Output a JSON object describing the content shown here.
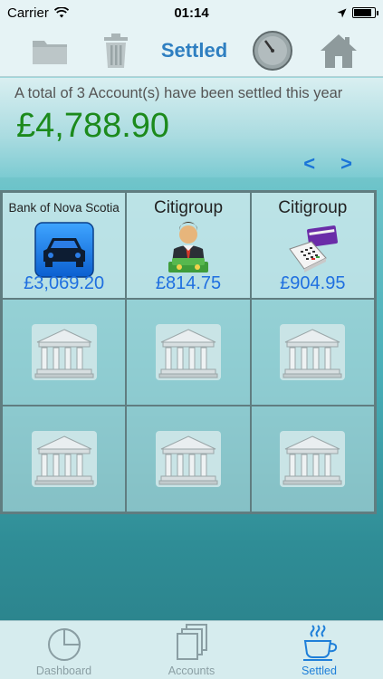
{
  "status_bar": {
    "carrier": "Carrier",
    "time": "01:14",
    "battery_level": 0.9
  },
  "toolbar": {
    "title": "Settled"
  },
  "summary": {
    "info": "A total of 3 Account(s) have been settled this year",
    "total": "£4,788.90",
    "prev": "<",
    "next": ">"
  },
  "grid": {
    "accounts": [
      {
        "bank": "Bank of Nova Scotia",
        "amount": "£3,069.20",
        "icon": "car-icon"
      },
      {
        "bank": "Citigroup",
        "amount": "£814.75",
        "icon": "businessman-money-icon"
      },
      {
        "bank": "Citigroup",
        "amount": "£904.95",
        "icon": "credit-card-terminal-icon"
      }
    ],
    "empty_icon": "bank-building-icon"
  },
  "tabbar": {
    "tabs": [
      {
        "label": "Dashboard",
        "icon": "pie-chart-icon"
      },
      {
        "label": "Accounts",
        "icon": "documents-icon"
      },
      {
        "label": "Settled",
        "icon": "coffee-cup-icon",
        "active": true
      }
    ]
  },
  "colors": {
    "accent": "#1e7fd9",
    "total": "#1c8a1c",
    "amount": "#1f6fe0"
  }
}
